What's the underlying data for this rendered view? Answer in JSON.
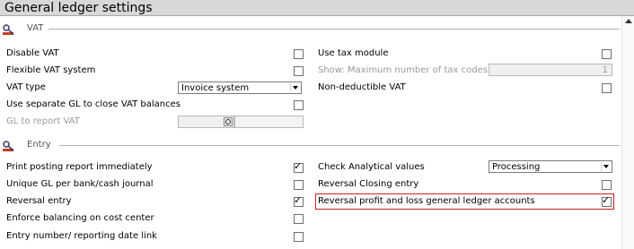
{
  "window": {
    "title": "General ledger settings"
  },
  "sections": {
    "vat": {
      "title": "VAT"
    },
    "entry": {
      "title": "Entry"
    }
  },
  "vat": {
    "disable_vat": {
      "label": "Disable VAT",
      "checked": false
    },
    "flexible_vat_system": {
      "label": "Flexible VAT system",
      "checked": false
    },
    "vat_type": {
      "label": "VAT type",
      "value": "Invoice system"
    },
    "separate_gl": {
      "label": "Use separate GL to close VAT balances",
      "checked": false
    },
    "gl_report_vat": {
      "label": "GL to report VAT",
      "value": ""
    },
    "use_tax_module": {
      "label": "Use tax module",
      "checked": false
    },
    "max_tax_codes": {
      "label": "Show: Maximum number of tax codes",
      "value": "1"
    },
    "non_deductible_vat": {
      "label": "Non-deductible VAT",
      "checked": false
    }
  },
  "entry": {
    "print_posting_report": {
      "label": "Print posting report immediately",
      "checked": true,
      "tick": "✓"
    },
    "unique_gl": {
      "label": "Unique GL per bank/cash journal",
      "checked": false
    },
    "reversal_entry": {
      "label": "Reversal entry",
      "checked": true,
      "tick": "✓"
    },
    "enforce_balancing": {
      "label": "Enforce balancing on cost center",
      "checked": false
    },
    "entry_number_link": {
      "label": "Entry number/ reporting date link",
      "checked": false
    },
    "check_analytical": {
      "label": "Check Analytical values",
      "value": "Processing"
    },
    "reversal_closing": {
      "label": "Reversal Closing entry",
      "checked": false
    },
    "reversal_pl": {
      "label": "Reversal profit and loss general ledger accounts",
      "checked": true,
      "tick": "✓"
    }
  },
  "icons": {
    "section": "settings-wrench-icon",
    "dropdown": "chevron-down-icon",
    "lookup": "magnifier-icon"
  },
  "colors": {
    "highlight": "#cc2020",
    "title_bar": "#d8d8d8"
  }
}
